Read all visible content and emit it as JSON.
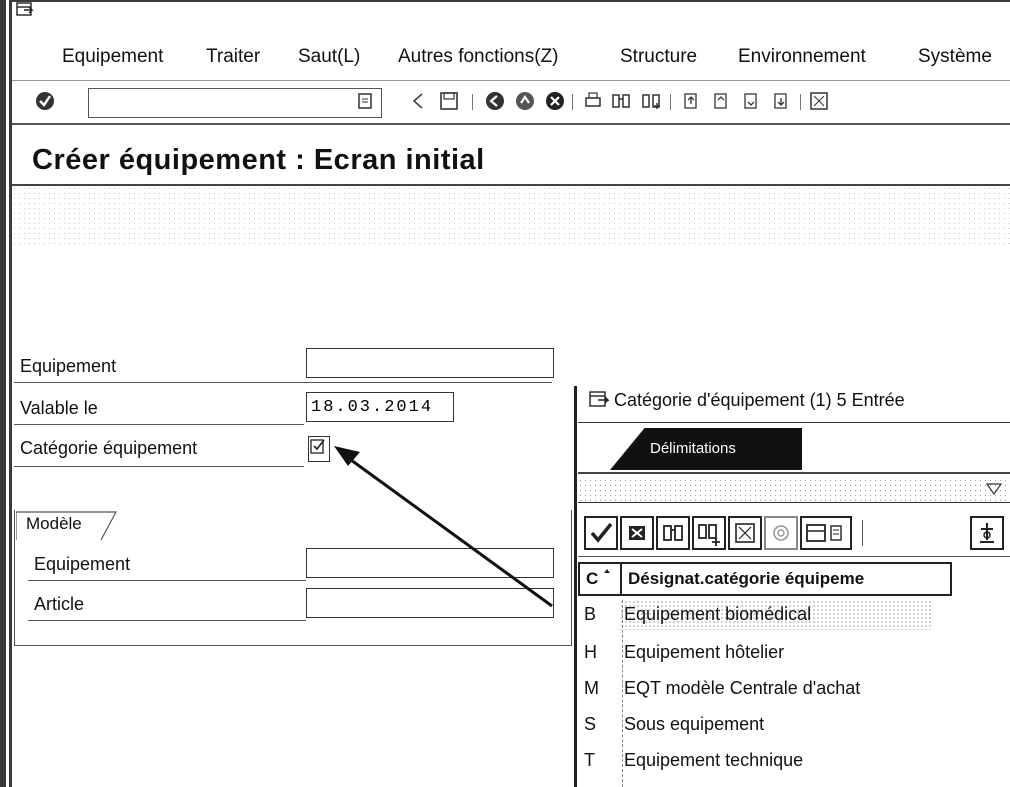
{
  "menu": [
    "Equipement",
    "Traiter",
    "Saut(L)",
    "Autres fonctions(Z)",
    "Structure",
    "Environnement",
    "Système"
  ],
  "toolbar": {
    "command_field_value": "",
    "icons": [
      "enter-icon",
      "input-history-icon",
      "back-arrow-icon",
      "save-icon",
      "back-green-icon",
      "exit-icon",
      "cancel-icon",
      "print-icon",
      "find-icon",
      "find-next-icon",
      "first-page-icon",
      "previous-page-icon",
      "next-page-icon",
      "last-page-icon",
      "layout-icon"
    ]
  },
  "page": {
    "title": "Créer équipement : Ecran initial"
  },
  "form": {
    "equipement_label": "Equipement",
    "equipement_value": "",
    "valable_label": "Valable le",
    "valable_value": "18.03.2014",
    "categorie_label": "Catégorie équipement",
    "categorie_value": ""
  },
  "modele_group": {
    "title": "Modèle",
    "equipement_label": "Equipement",
    "equipement_value": "",
    "article_label": "Article",
    "article_value": ""
  },
  "popup": {
    "title": "Catégorie d'équipement (1)   5 Entrée",
    "tab_label": "Délimitations",
    "col_code": "C",
    "col_desc": "Désignat.catégorie équipeme",
    "rows": [
      {
        "code": "B",
        "desc": "Equipement biomédical"
      },
      {
        "code": "H",
        "desc": "Equipement hôtelier"
      },
      {
        "code": "M",
        "desc": "EQT modèle Centrale d'achat"
      },
      {
        "code": "S",
        "desc": "Sous equipement"
      },
      {
        "code": "T",
        "desc": "Equipement technique"
      }
    ]
  }
}
